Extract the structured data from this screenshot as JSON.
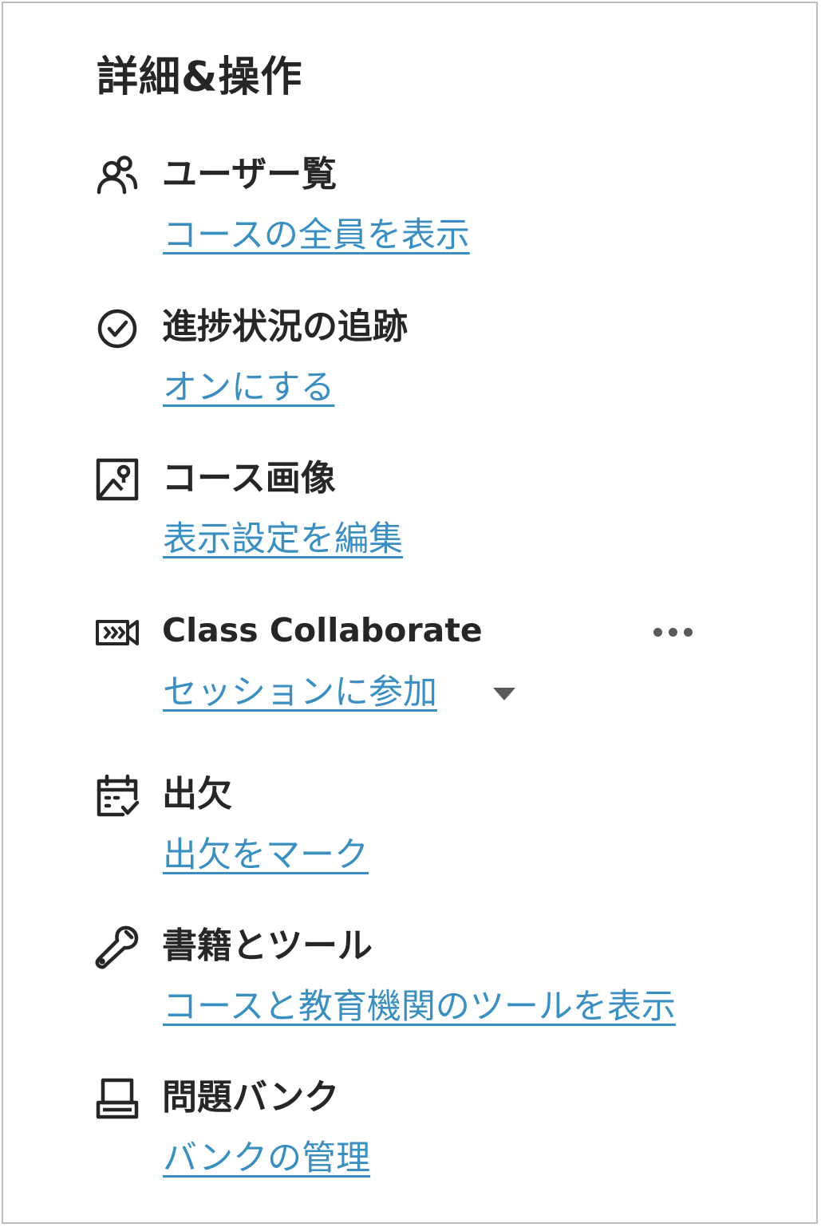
{
  "panel": {
    "title": "詳細&操作"
  },
  "items": [
    {
      "icon": "users-icon",
      "title": "ユーザー覧",
      "link": "コースの全員を表示"
    },
    {
      "icon": "check-circle-icon",
      "title": "進捗状況の追跡",
      "link": "オンにする"
    },
    {
      "icon": "image-icon",
      "title": "コース画像",
      "link": "表示設定を編集"
    },
    {
      "icon": "video-camera-icon",
      "title": "Class Collaborate",
      "link": "セッションに参加",
      "has_menu": true,
      "has_dropdown": true
    },
    {
      "icon": "calendar-check-icon",
      "title": "出欠",
      "link": "出欠をマーク"
    },
    {
      "icon": "wrench-icon",
      "title": "書籍とツール",
      "link": "コースと教育機関のツールを表示"
    },
    {
      "icon": "question-bank-icon",
      "title": "問題バンク",
      "link": "バンクの管理"
    }
  ],
  "colors": {
    "link": "#3a8fc0",
    "text": "#262626",
    "icon": "#262626",
    "border": "#bdbdbd"
  }
}
